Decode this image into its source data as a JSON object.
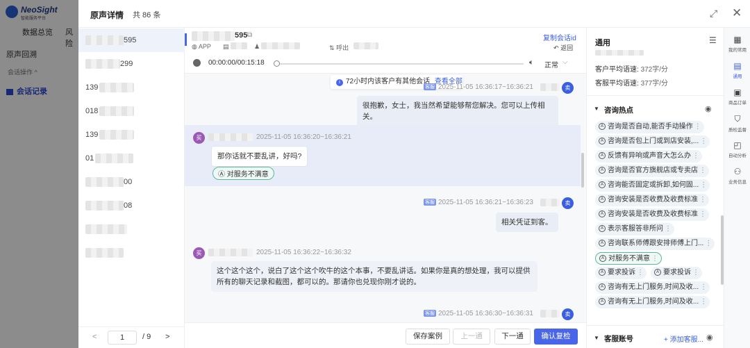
{
  "background": {
    "logo_name": "NeoSight",
    "logo_sub": "智能服务平台",
    "top_nav": [
      "数据总览",
      "风险"
    ],
    "side_nav": {
      "section": "原声回溯",
      "group": "会话操作 ^",
      "active_item": "会话记录"
    }
  },
  "modal": {
    "title": "原声详情",
    "count": "共 86 条",
    "expand_icon": "expand-icon",
    "close_icon": "close-icon"
  },
  "list": {
    "items": [
      {
        "suffix": "595",
        "prefix": ""
      },
      {
        "suffix": "299",
        "prefix": ""
      },
      {
        "suffix": "",
        "prefix": "139"
      },
      {
        "suffix": "",
        "prefix": "018"
      },
      {
        "suffix": "",
        "prefix": "139"
      },
      {
        "suffix": "",
        "prefix": "01"
      },
      {
        "suffix": "00",
        "prefix": ""
      },
      {
        "suffix": "08",
        "prefix": ""
      },
      {
        "suffix": "",
        "prefix": ""
      },
      {
        "suffix": "",
        "prefix": ""
      }
    ],
    "pager": {
      "current": "1",
      "total": "/ 9",
      "prev": "<",
      "next": ">"
    }
  },
  "conversation": {
    "id_suffix": "595",
    "channel": "APP",
    "direction": "呼出",
    "copy_label": "复制会话id",
    "back_label": "返回",
    "audio": {
      "time": "00:00:00/00:15:18",
      "speed": "正常"
    },
    "notice": {
      "text": "72小时内该客户有其他会话",
      "link": "查看全部"
    },
    "messages": [
      {
        "role": "agent",
        "avatar": "卖",
        "time": "2025-11-05 16:36:17~16:36:21",
        "tag": "客服",
        "text": "很抱歉，女士，我当然希望能够帮您解决。您可以上传相关。"
      },
      {
        "role": "customer",
        "avatar": "买",
        "time": "2025-11-05 16:36:20~16:36:21",
        "text": "那你话就不要乱讲，好吗?",
        "label": "对服务不满意"
      },
      {
        "role": "agent",
        "avatar": "卖",
        "time": "2025-11-05 16:36:21~16:36:23",
        "tag": "客服",
        "text": "相关凭证到客。"
      },
      {
        "role": "customer",
        "avatar": "买",
        "time": "2025-11-05 16:36:22~16:36:32",
        "text": "这个这个这个，说白了这个这个吹牛的这个本事，不要乱讲话。如果你是真的想处理，我可以提供所有的聊天记录和截图，都可以的。那请你也兑现你刚才说的。"
      },
      {
        "role": "agent",
        "avatar": "卖",
        "time": "2025-11-05 16:36:30~16:36:31",
        "tag": "客服",
        "text": ""
      }
    ],
    "footer": {
      "save": "保存案例",
      "prev": "上一通",
      "next": "下一通",
      "confirm": "确认复检"
    }
  },
  "right_panel": {
    "title": "通用",
    "stats": [
      {
        "label": "客户平均语速:",
        "value": "372字/分"
      },
      {
        "label": "客服平均语速:",
        "value": "377字/分"
      }
    ],
    "hot_title": "咨询热点",
    "hot_tags": [
      "咨询是否自动,能否手动操作",
      "咨询是否包上门或到店安装,...",
      "反馈有异响或声音大怎么办",
      "咨询是否官方旗舰店或专卖店",
      "咨询能否固定或拆卸,如何固...",
      "咨询安装是否收费及收费标准",
      "咨询安装是否收费及收费标准",
      "表示客服答非所问",
      "咨询联系师傅跟安排师傅上门...",
      "对服务不满意",
      "要求投诉",
      "要求投诉",
      "咨询有无上门服务,时间及收...",
      "咨询有无上门服务,时间及收..."
    ],
    "account_title": "客服账号",
    "account_add": "+ 添加客服..."
  },
  "rail": [
    {
      "label": "我的常用",
      "icon": "grid-icon"
    },
    {
      "label": "通用",
      "icon": "chat-icon"
    },
    {
      "label": "商品订单",
      "icon": "clipboard-icon"
    },
    {
      "label": "质检监督",
      "icon": "shield-icon"
    },
    {
      "label": "自动分析",
      "icon": "chart-icon"
    },
    {
      "label": "业务信息",
      "icon": "people-icon"
    }
  ]
}
